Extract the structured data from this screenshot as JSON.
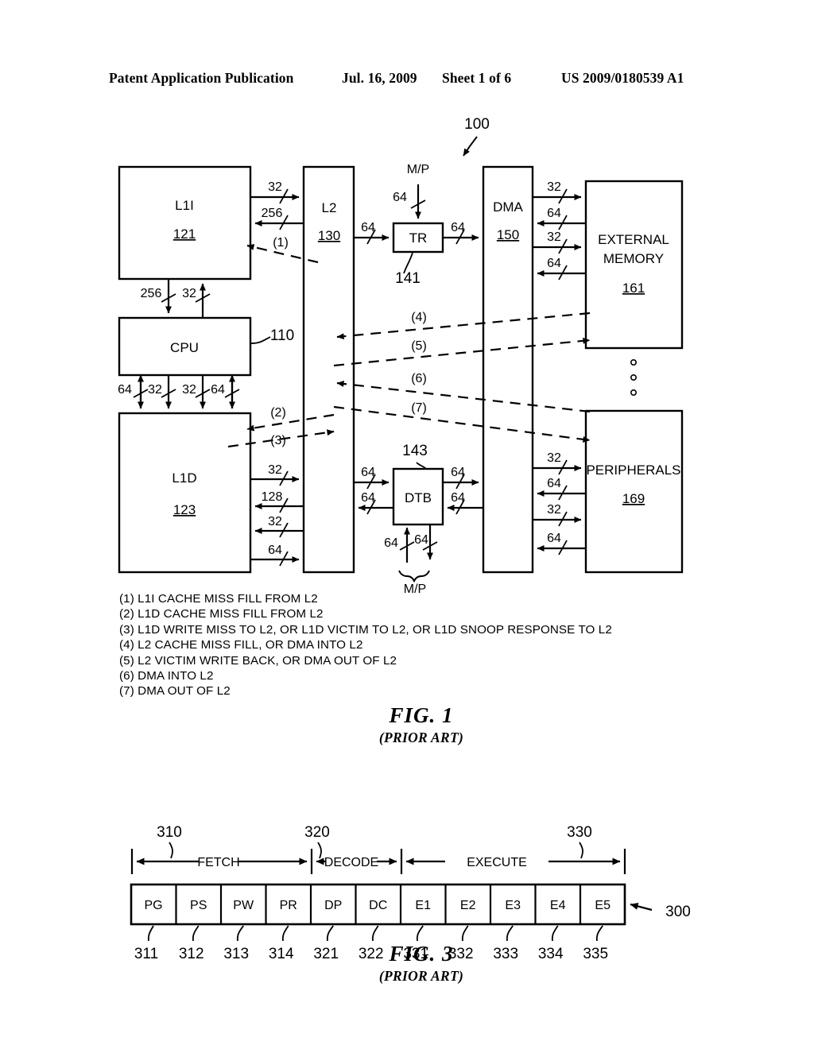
{
  "header": {
    "left": "Patent Application Publication",
    "date": "Jul. 16, 2009",
    "sheet": "Sheet 1 of 6",
    "patent_number": "US 2009/0180539 A1"
  },
  "fig1": {
    "system_ref": "100",
    "blocks": {
      "l1i": {
        "label": "L1I",
        "ref": "121"
      },
      "cpu": {
        "label": "CPU",
        "ref": "110"
      },
      "l1d": {
        "label": "L1D",
        "ref": "123"
      },
      "l2": {
        "label": "L2",
        "ref": "130"
      },
      "tr": {
        "label": "TR",
        "ref": "141"
      },
      "dtb": {
        "label": "DTB",
        "ref": "143"
      },
      "dma": {
        "label": "DMA",
        "ref": "150"
      },
      "extmem": {
        "label_line1": "EXTERNAL",
        "label_line2": "MEMORY",
        "ref": "161"
      },
      "periph": {
        "label": "PERIPHERALS",
        "ref": "169"
      }
    },
    "mp_labels": {
      "top": "M/P",
      "bottom": "M/P"
    },
    "bus_widths": {
      "l1i_to_l2": "32",
      "l2_to_l1i": "256",
      "l1i_to_cpu": "256",
      "cpu_to_l1i": "32",
      "cpu_l1d_a": "64",
      "cpu_l1d_b": "32",
      "cpu_l1d_c": "32",
      "cpu_l1d_d": "64",
      "l1d_to_l2_a": "32",
      "l2_to_l1d_b": "128",
      "l2_to_l1d_c": "32",
      "l1d_to_l2_d": "64",
      "mp_to_tr": "64",
      "l2_to_tr": "64",
      "tr_to_dma": "64",
      "dma_extmem_a": "32",
      "dma_extmem_b": "64",
      "dma_extmem_c": "32",
      "dma_extmem_d": "64",
      "dma_periph_a": "32",
      "dma_periph_b": "64",
      "dma_periph_c": "32",
      "dma_periph_d": "64",
      "l2_to_dtb": "64",
      "dtb_to_l2": "64",
      "dtb_to_dma_a": "64",
      "dma_to_dtb_b": "64",
      "mp_to_dtb": "64",
      "dtb_to_mp": "64"
    },
    "flow_markers": [
      "(1)",
      "(2)",
      "(3)",
      "(4)",
      "(5)",
      "(6)",
      "(7)"
    ],
    "legend": [
      "(1) L1I CACHE MISS FILL FROM L2",
      "(2) L1D CACHE MISS FILL FROM L2",
      "(3) L1D WRITE MISS TO L2, OR L1D VICTIM TO L2, OR L1D SNOOP RESPONSE TO L2",
      "(4) L2 CACHE MISS FILL, OR DMA INTO L2",
      "(5) L2 VICTIM WRITE BACK, OR DMA OUT OF L2",
      "(6) DMA INTO L2",
      "(7) DMA OUT OF L2"
    ],
    "caption_main": "FIG. 1",
    "caption_sub": "(PRIOR ART)"
  },
  "fig3": {
    "pipeline_ref": "300",
    "phases": [
      {
        "name": "FETCH",
        "ref": "310"
      },
      {
        "name": "DECODE",
        "ref": "320"
      },
      {
        "name": "EXECUTE",
        "ref": "330"
      }
    ],
    "stages": [
      {
        "label": "PG",
        "ref": "311"
      },
      {
        "label": "PS",
        "ref": "312"
      },
      {
        "label": "PW",
        "ref": "313"
      },
      {
        "label": "PR",
        "ref": "314"
      },
      {
        "label": "DP",
        "ref": "321"
      },
      {
        "label": "DC",
        "ref": "322"
      },
      {
        "label": "E1",
        "ref": "331"
      },
      {
        "label": "E2",
        "ref": "332"
      },
      {
        "label": "E3",
        "ref": "333"
      },
      {
        "label": "E4",
        "ref": "334"
      },
      {
        "label": "E5",
        "ref": "335"
      }
    ],
    "caption_main": "FIG. 3",
    "caption_sub": "(PRIOR ART)"
  }
}
